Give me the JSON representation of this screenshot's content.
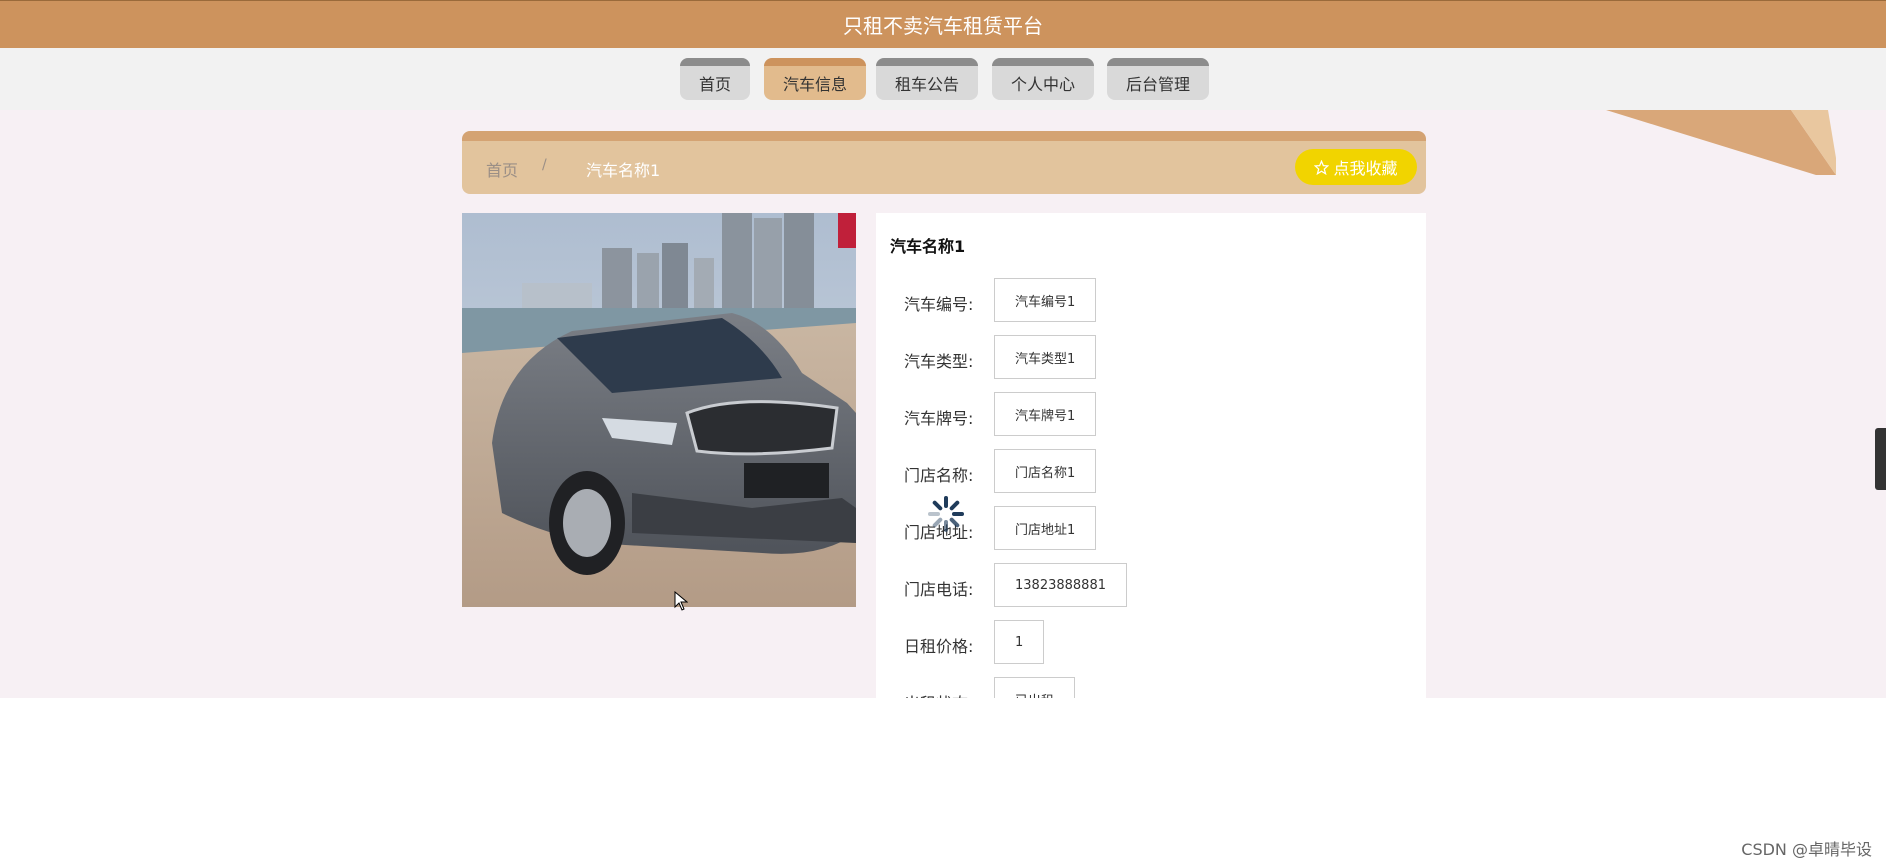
{
  "site_title": "只租不卖汽车租赁平台",
  "nav": {
    "items": [
      {
        "label": "首页"
      },
      {
        "label": "汽车信息"
      },
      {
        "label": "租车公告"
      },
      {
        "label": "个人中心"
      },
      {
        "label": "后台管理"
      }
    ],
    "active": "汽车信息"
  },
  "breadcrumb": {
    "home": "首页",
    "separator": "/",
    "current": "汽车名称1"
  },
  "favorite_button": "点我收藏",
  "detail": {
    "title": "汽车名称1",
    "fields": [
      {
        "label": "汽车编号:",
        "value": "汽车编号1"
      },
      {
        "label": "汽车类型:",
        "value": "汽车类型1"
      },
      {
        "label": "汽车牌号:",
        "value": "汽车牌号1"
      },
      {
        "label": "门店名称:",
        "value": "门店名称1"
      },
      {
        "label": "门店地址:",
        "value": "门店地址1"
      },
      {
        "label": "门店电话:",
        "value": "13823888881"
      },
      {
        "label": "日租价格:",
        "value": "1"
      },
      {
        "label": "出租状态:",
        "value": "已出租"
      }
    ]
  },
  "watermark": "CSDN @卓晴毕设",
  "colors": {
    "header": "#cd935d",
    "nav_active": "#e2bb8d",
    "breadcrumb_bg": "#e2c49d",
    "favorite": "#f1d400",
    "page_bg": "#f7f0f4"
  }
}
